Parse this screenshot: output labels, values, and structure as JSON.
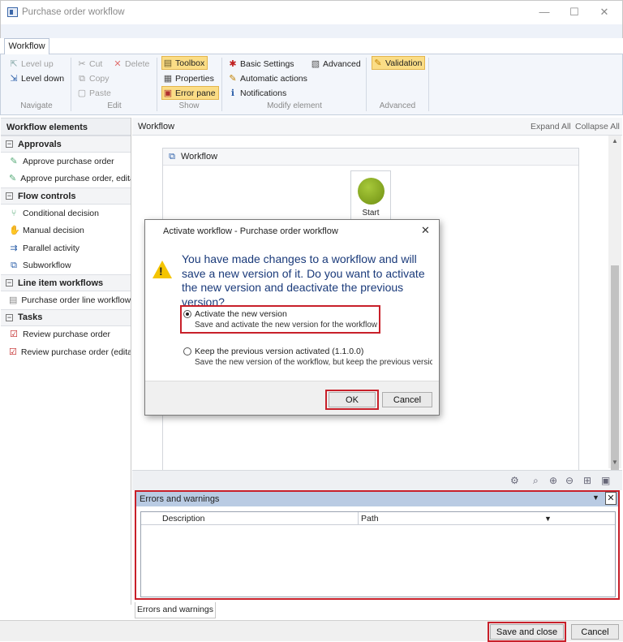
{
  "window": {
    "title": "Purchase order workflow",
    "minimize": "—",
    "maximize": "☐",
    "close": "✕"
  },
  "ribbon": {
    "tab": "Workflow",
    "navigate": {
      "label": "Navigate",
      "level_up": "Level up",
      "level_down": "Level down"
    },
    "edit": {
      "label": "Edit",
      "cut": "Cut",
      "delete": "Delete",
      "copy": "Copy",
      "paste": "Paste"
    },
    "show": {
      "label": "Show",
      "toolbox": "Toolbox",
      "properties": "Properties",
      "error_pane": "Error pane"
    },
    "modify": {
      "label": "Modify element",
      "basic_settings": "Basic Settings",
      "advanced": "Advanced",
      "automatic_actions": "Automatic actions",
      "notifications": "Notifications"
    },
    "advanced": {
      "label": "Advanced",
      "validation": "Validation"
    }
  },
  "toolbox": {
    "title": "Workflow elements",
    "sections": [
      {
        "name": "Approvals",
        "items": [
          "Approve purchase order",
          "Approve purchase order, editable"
        ]
      },
      {
        "name": "Flow controls",
        "items": [
          "Conditional decision",
          "Manual decision",
          "Parallel activity",
          "Subworkflow"
        ]
      },
      {
        "name": "Line item workflows",
        "items": [
          "Purchase order line workflow"
        ]
      },
      {
        "name": "Tasks",
        "items": [
          "Review purchase order",
          "Review purchase order (editable)"
        ]
      }
    ]
  },
  "designer": {
    "title": "Workflow",
    "expand_all": "Expand All",
    "collapse_all": "Collapse All",
    "canvas_title": "Workflow",
    "start_label": "Start"
  },
  "errors": {
    "title": "Errors and warnings",
    "col_description": "Description",
    "col_path": "Path",
    "tab": "Errors and warnings"
  },
  "footer": {
    "save_close": "Save and close",
    "cancel": "Cancel"
  },
  "dialog": {
    "title": "Activate workflow - Purchase order workflow",
    "message": "You have made changes to a workflow and will save a new version of it. Do you want to activate the new version and deactivate the previous version?",
    "option1_title": "Activate the new version",
    "option1_desc": "Save and activate the new version for the workflow",
    "option2_title": "Keep the previous version activated (1.1.0.0)",
    "option2_desc": "Save the new version of the workflow, but keep the previous versic",
    "ok": "OK",
    "cancel": "Cancel",
    "selected_option": 1
  },
  "colors": {
    "highlight": "#c8202a",
    "ribbon_active": "#fbdd86",
    "start_node": "#8aac22",
    "warning": "#f4c400"
  }
}
